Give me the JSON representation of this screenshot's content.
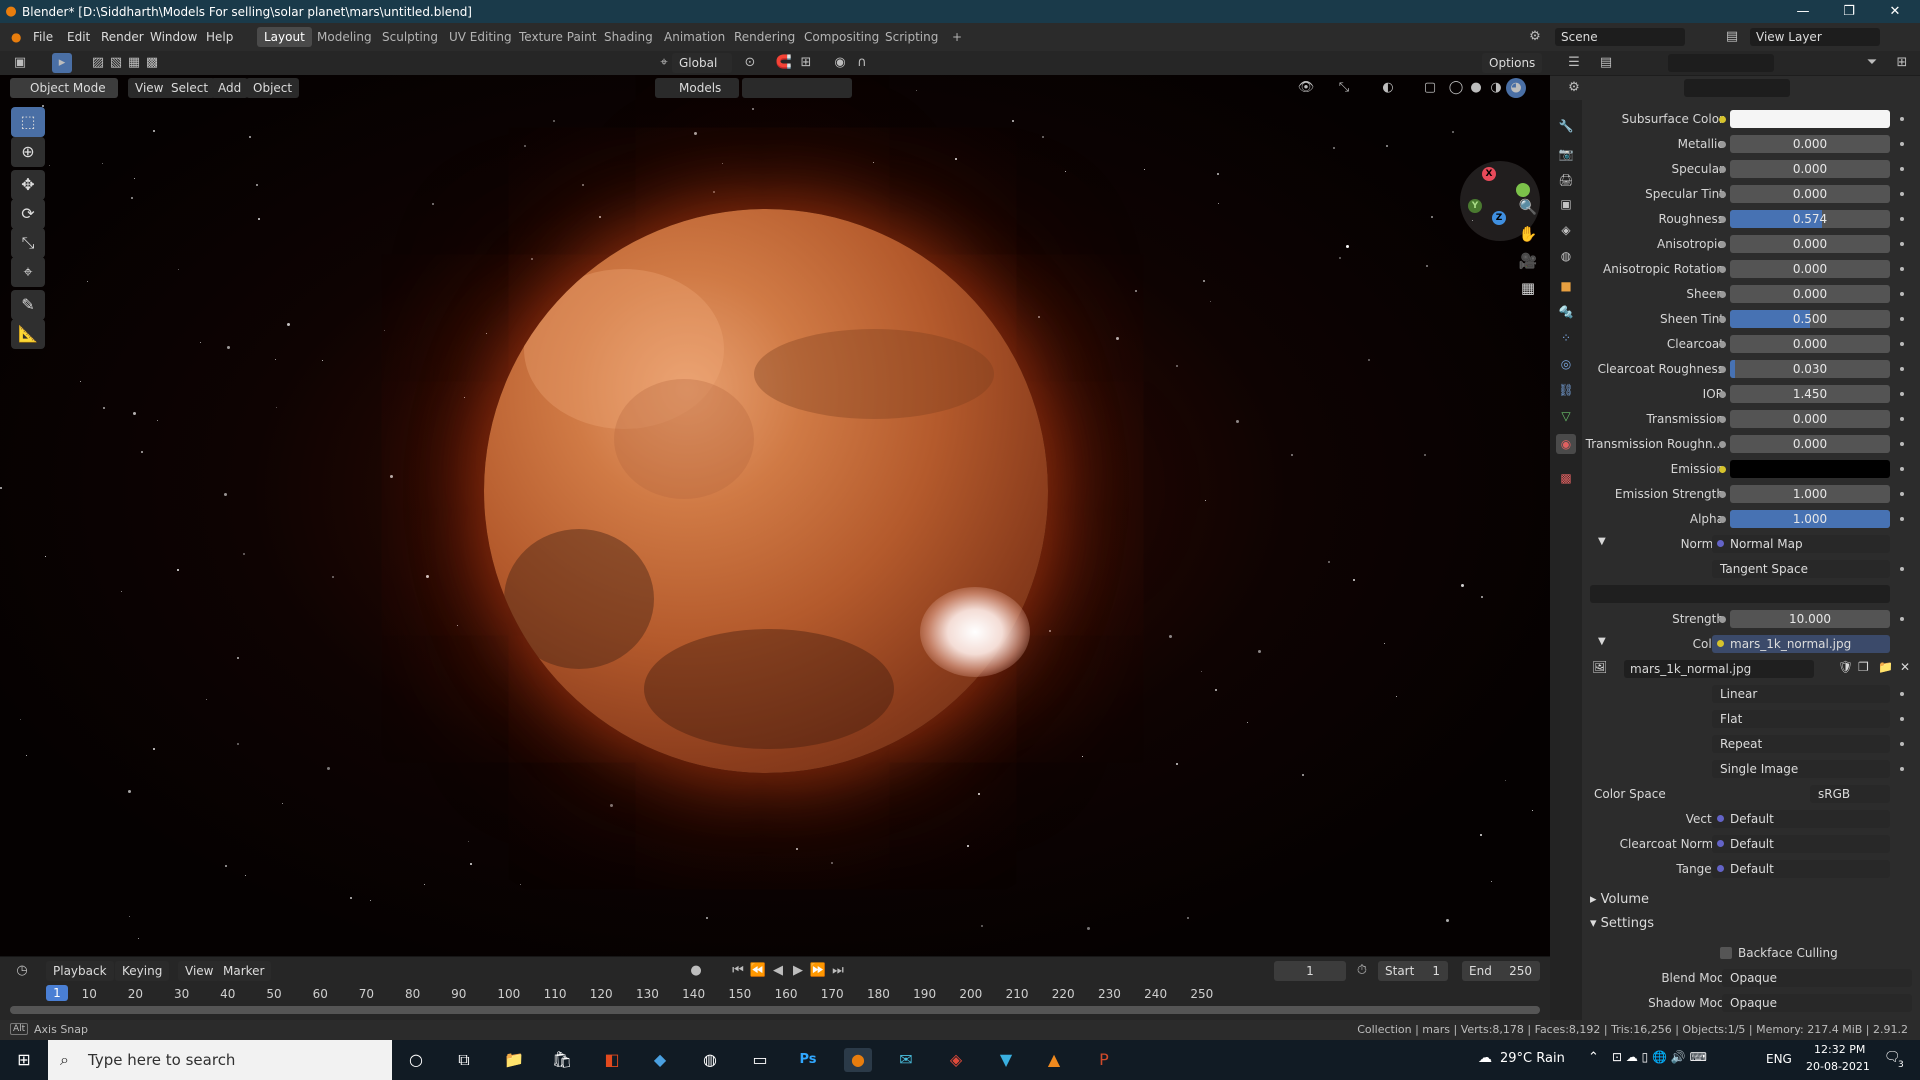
{
  "window": {
    "title": "Blender* [D:\\Siddharth\\Models For selling\\solar planet\\mars\\untitled.blend]",
    "minimize": "—",
    "maximize": "❐",
    "close": "✕"
  },
  "menus": [
    "File",
    "Edit",
    "Render",
    "Window",
    "Help"
  ],
  "workspaces": [
    "Layout",
    "Modeling",
    "Sculpting",
    "UV Editing",
    "Texture Paint",
    "Shading",
    "Animation",
    "Rendering",
    "Compositing",
    "Scripting"
  ],
  "workspace_add": "+",
  "scene": {
    "label": "Scene",
    "view_layer": "View Layer"
  },
  "viewport_header": {
    "transform": "Global",
    "options": "Options",
    "mode": "Object Mode",
    "view": "View",
    "select": "Select",
    "add": "Add",
    "object": "Object",
    "collection": "Models"
  },
  "timeline": {
    "playback": "Playback",
    "keying": "Keying",
    "view": "View",
    "marker": "Marker",
    "current_frame": "1",
    "start_label": "Start",
    "start": "1",
    "end_label": "End",
    "end": "250",
    "ticks": [
      "10",
      "20",
      "30",
      "40",
      "50",
      "60",
      "70",
      "80",
      "90",
      "100",
      "110",
      "120",
      "130",
      "140",
      "150",
      "160",
      "170",
      "180",
      "190",
      "200",
      "210",
      "220",
      "230",
      "240",
      "250"
    ]
  },
  "statusbar": {
    "left_key": "Alt",
    "left": "Axis Snap",
    "right": "Collection | mars | Verts:8,178 | Faces:8,192 | Tris:16,256 | Objects:1/5 | Memory: 217.4 MiB | 2.91.2"
  },
  "properties": {
    "rows": [
      {
        "label": "Subsurface Color",
        "type": "color",
        "color": "#f5f5f5",
        "socket": "yellow"
      },
      {
        "label": "Metallic",
        "value": "0.000",
        "fill": 0
      },
      {
        "label": "Specular",
        "value": "0.000",
        "fill": 0
      },
      {
        "label": "Specular Tint",
        "value": "0.000",
        "fill": 0
      },
      {
        "label": "Roughness",
        "value": "0.574",
        "fill": 0.574
      },
      {
        "label": "Anisotropic",
        "value": "0.000",
        "fill": 0
      },
      {
        "label": "Anisotropic Rotation",
        "value": "0.000",
        "fill": 0
      },
      {
        "label": "Sheen",
        "value": "0.000",
        "fill": 0
      },
      {
        "label": "Sheen Tint",
        "value": "0.500",
        "fill": 0.5
      },
      {
        "label": "Clearcoat",
        "value": "0.000",
        "fill": 0
      },
      {
        "label": "Clearcoat Roughness",
        "value": "0.030",
        "fill": 0.03
      },
      {
        "label": "IOR",
        "value": "1.450",
        "fill": 0
      },
      {
        "label": "Transmission",
        "value": "0.000",
        "fill": 0
      },
      {
        "label": "Transmission Roughn...",
        "value": "0.000",
        "fill": 0
      },
      {
        "label": "Emission",
        "type": "color",
        "color": "#000000",
        "socket": "yellow"
      },
      {
        "label": "Emission Strength",
        "value": "1.000",
        "fill": 0
      },
      {
        "label": "Alpha",
        "value": "1.000",
        "fill": 1
      }
    ],
    "normal": {
      "label": "Normal",
      "link": "Normal Map",
      "space": "Tangent Space"
    },
    "strength": {
      "label": "Strength",
      "value": "10.000"
    },
    "color": {
      "label": "Color",
      "link": "mars_1k_normal.jpg"
    },
    "image": {
      "name": "mars_1k_normal.jpg",
      "interpolation": "Linear",
      "projection": "Flat",
      "extension": "Repeat",
      "source": "Single Image",
      "color_space_label": "Color Space",
      "color_space": "sRGB"
    },
    "inputs": [
      {
        "label": "Vector",
        "value": "Default"
      },
      {
        "label": "Clearcoat Normal",
        "value": "Default"
      },
      {
        "label": "Tangent",
        "value": "Default"
      }
    ],
    "volume": "Volume",
    "settings": "Settings",
    "backface_culling": "Backface Culling",
    "blend_mode": {
      "label": "Blend Mode",
      "value": "Opaque"
    },
    "shadow_mode": {
      "label": "Shadow Mode",
      "value": "Opaque"
    }
  },
  "taskbar": {
    "search_placeholder": "Type here to search",
    "weather": "29°C  Rain",
    "lang": "ENG",
    "time": "12:32 PM",
    "date": "20-08-2021",
    "notif": "3"
  },
  "colors": {
    "accent": "#4772b3",
    "title_bar": "#1a3a4a",
    "panel": "#2c2c2c"
  }
}
